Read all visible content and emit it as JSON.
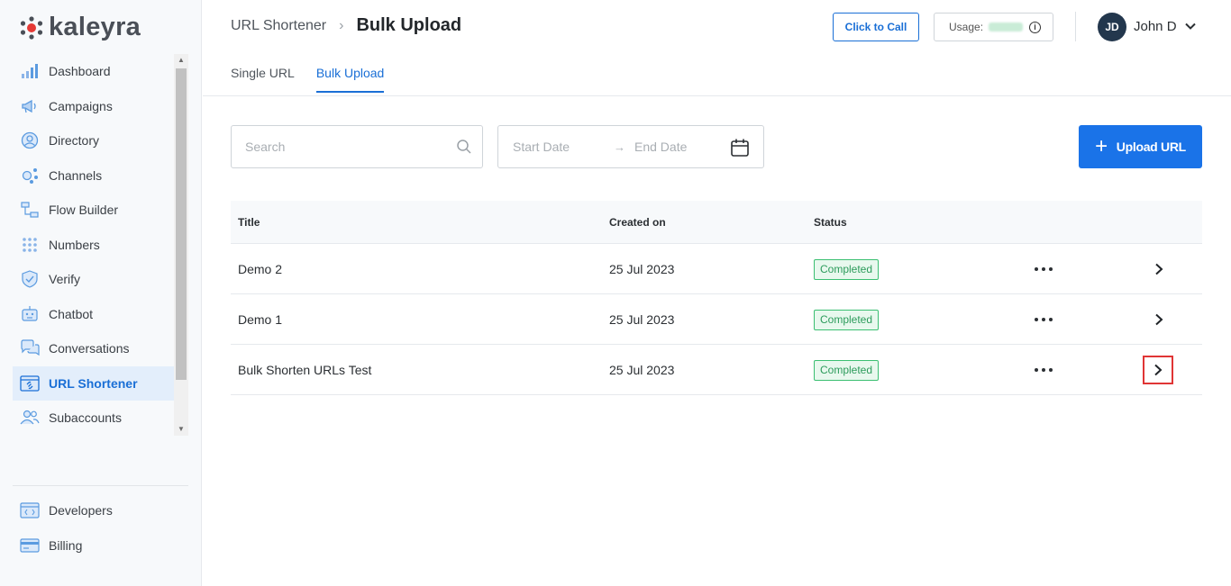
{
  "brand": {
    "name": "kaleyra",
    "accent": "#1a73e8"
  },
  "sidebar": {
    "items": [
      {
        "label": "Dashboard",
        "icon": "bar-chart-icon"
      },
      {
        "label": "Campaigns",
        "icon": "megaphone-icon"
      },
      {
        "label": "Directory",
        "icon": "user-circle-icon"
      },
      {
        "label": "Channels",
        "icon": "channels-icon"
      },
      {
        "label": "Flow Builder",
        "icon": "flow-icon"
      },
      {
        "label": "Numbers",
        "icon": "dialpad-icon"
      },
      {
        "label": "Verify",
        "icon": "shield-check-icon"
      },
      {
        "label": "Chatbot",
        "icon": "robot-icon"
      },
      {
        "label": "Conversations",
        "icon": "chat-bubbles-icon"
      },
      {
        "label": "URL Shortener",
        "icon": "link-icon",
        "active": true
      },
      {
        "label": "Subaccounts",
        "icon": "users-icon"
      }
    ],
    "bottom": [
      {
        "label": "Developers",
        "icon": "code-icon"
      },
      {
        "label": "Billing",
        "icon": "card-icon"
      }
    ]
  },
  "header": {
    "breadcrumb_parent": "URL Shortener",
    "breadcrumb_sep": "›",
    "title": "Bulk Upload",
    "click_to_call": "Click to Call",
    "usage_label": "Usage:",
    "user_initials": "JD",
    "user_name": "John D"
  },
  "tabs": [
    {
      "label": "Single URL",
      "active": false
    },
    {
      "label": "Bulk Upload",
      "active": true
    }
  ],
  "toolbar": {
    "search_placeholder": "Search",
    "start_date_placeholder": "Start Date",
    "end_date_placeholder": "End Date",
    "date_arrow": "→",
    "upload_label": "Upload URL"
  },
  "table": {
    "columns": {
      "title": "Title",
      "created": "Created on",
      "status": "Status"
    },
    "rows": [
      {
        "title": "Demo 2",
        "created": "25 Jul 2023",
        "status": "Completed"
      },
      {
        "title": "Demo 1",
        "created": "25 Jul 2023",
        "status": "Completed"
      },
      {
        "title": "Bulk Shorten URLs Test",
        "created": "25 Jul 2023",
        "status": "Completed",
        "highlighted": true
      }
    ]
  }
}
